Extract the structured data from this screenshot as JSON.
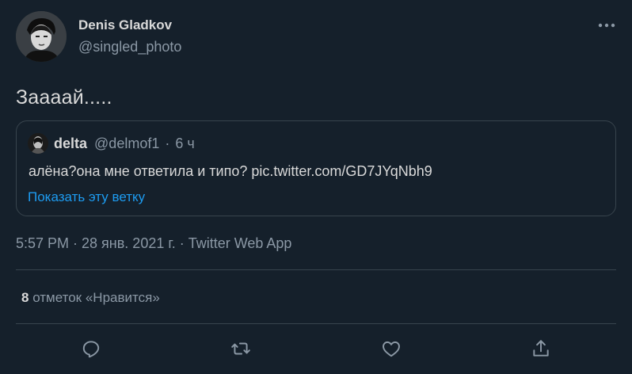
{
  "author": {
    "name": "Denis Gladkov",
    "handle": "@singled_photo"
  },
  "tweet": {
    "text": "Заааай....."
  },
  "quoted": {
    "name": "delta",
    "handle": "@delmof1",
    "time": "6 ч",
    "text": "алёна?она мне ответила и типо? pic.twitter.com/GD7JYqNbh9",
    "show_thread": "Показать эту ветку"
  },
  "meta": {
    "timestamp": "5:57 PM · 28 янв. 2021 г. · Twitter Web App"
  },
  "stats": {
    "likes_count": "8",
    "likes_label": " отметок «Нравится»"
  },
  "actions": {
    "reply_icon": "reply-icon",
    "retweet_icon": "retweet-icon",
    "like_icon": "heart-icon",
    "share_icon": "share-icon"
  },
  "colors": {
    "background": "#15202b",
    "text": "#d9d9d9",
    "secondary": "#8b98a5",
    "link": "#1d9bf0",
    "border": "#38444d"
  }
}
